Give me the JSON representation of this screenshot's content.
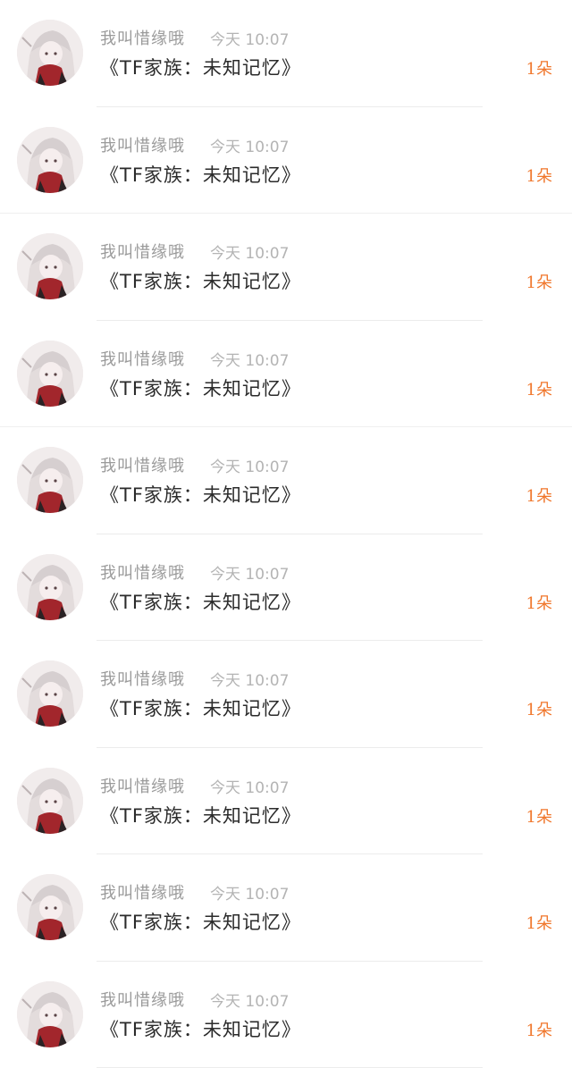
{
  "colors": {
    "accent": "#f0762b",
    "username": "#9a9a9a",
    "time": "#b4b4b4",
    "message": "#2b2b2b",
    "divider": "#ececec"
  },
  "records": [
    {
      "avatar_icon": "anime-avatar-icon",
      "username": "我叫惜缘哦",
      "time": "今天 10:07",
      "message": "《TF家族：未知记忆》",
      "gift": "1朵"
    },
    {
      "avatar_icon": "anime-avatar-icon",
      "username": "我叫惜缘哦",
      "time": "今天 10:07",
      "message": "《TF家族：未知记忆》",
      "gift": "1朵"
    },
    {
      "avatar_icon": "anime-avatar-icon",
      "username": "我叫惜缘哦",
      "time": "今天 10:07",
      "message": "《TF家族：未知记忆》",
      "gift": "1朵"
    },
    {
      "avatar_icon": "anime-avatar-icon",
      "username": "我叫惜缘哦",
      "time": "今天 10:07",
      "message": "《TF家族：未知记忆》",
      "gift": "1朵"
    },
    {
      "avatar_icon": "anime-avatar-icon",
      "username": "我叫惜缘哦",
      "time": "今天 10:07",
      "message": "《TF家族：未知记忆》",
      "gift": "1朵"
    },
    {
      "avatar_icon": "anime-avatar-icon",
      "username": "我叫惜缘哦",
      "time": "今天 10:07",
      "message": "《TF家族：未知记忆》",
      "gift": "1朵"
    },
    {
      "avatar_icon": "anime-avatar-icon",
      "username": "我叫惜缘哦",
      "time": "今天 10:07",
      "message": "《TF家族：未知记忆》",
      "gift": "1朵"
    },
    {
      "avatar_icon": "anime-avatar-icon",
      "username": "我叫惜缘哦",
      "time": "今天 10:07",
      "message": "《TF家族：未知记忆》",
      "gift": "1朵"
    },
    {
      "avatar_icon": "anime-avatar-icon",
      "username": "我叫惜缘哦",
      "time": "今天 10:07",
      "message": "《TF家族：未知记忆》",
      "gift": "1朵"
    },
    {
      "avatar_icon": "anime-avatar-icon",
      "username": "我叫惜缘哦",
      "time": "今天 10:07",
      "message": "《TF家族：未知记忆》",
      "gift": "1朵"
    }
  ]
}
